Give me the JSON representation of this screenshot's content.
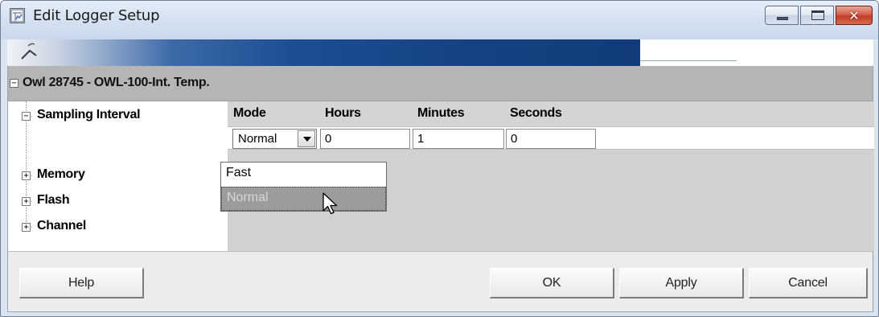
{
  "window": {
    "title": "Edit Logger Setup",
    "icons": {
      "app": "logger-app-icon",
      "minimize": "minimize-icon",
      "maximize": "maximize-icon",
      "close": "close-icon",
      "close_glyph": "✕"
    }
  },
  "device": {
    "expander": "−",
    "title": "Owl 28745 - OWL-100-Int. Temp."
  },
  "tree": {
    "items": [
      {
        "label": "Sampling Interval",
        "expander": "−"
      },
      {
        "label": "Memory",
        "expander": "+"
      },
      {
        "label": "Flash",
        "expander": "+"
      },
      {
        "label": "Channel",
        "expander": "+"
      }
    ]
  },
  "sampling": {
    "headers": {
      "mode": "Mode",
      "hours": "Hours",
      "minutes": "Minutes",
      "seconds": "Seconds"
    },
    "mode_value": "Normal",
    "hours_value": "0",
    "minutes_value": "1",
    "seconds_value": "0"
  },
  "mode_dropdown": {
    "options": [
      "Fast",
      "Normal"
    ],
    "highlighted": "Normal"
  },
  "buttons": {
    "help": "Help",
    "ok": "OK",
    "apply": "Apply",
    "cancel": "Cancel"
  },
  "colors": {
    "banner_blue": "#1d4e93",
    "header_gray": "#b5b5b5",
    "close_red": "#c23c24"
  }
}
